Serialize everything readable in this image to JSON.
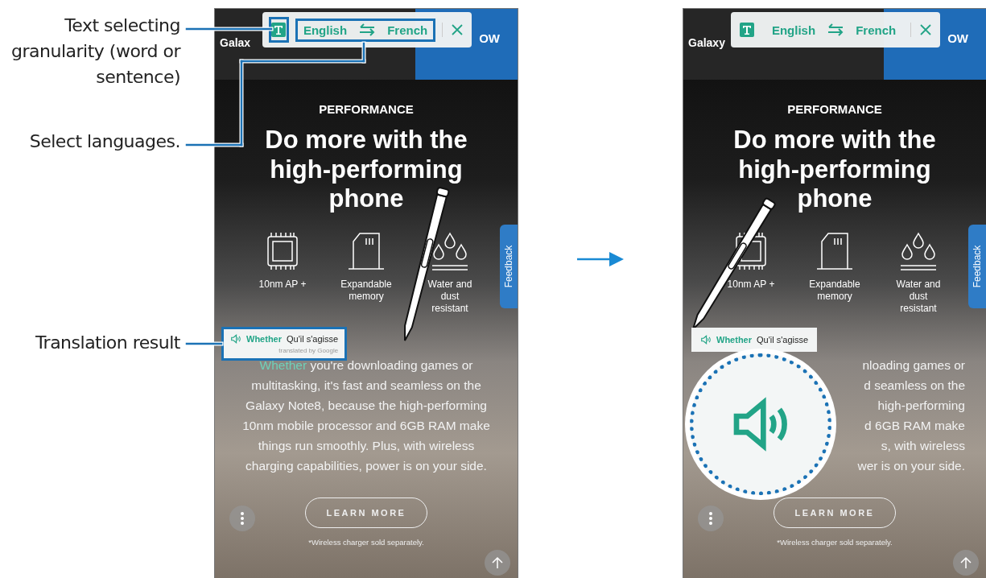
{
  "callouts": [
    {
      "text": "Text selecting granularity (word or sentence)"
    },
    {
      "text": "Select languages."
    },
    {
      "text": "Translation result"
    }
  ],
  "screens": [
    {
      "kind": "plain",
      "header": {
        "title": "Galax",
        "button": "OW"
      },
      "toolbar": {
        "source": "English",
        "target": "French",
        "highlighted": true
      },
      "section_label": "PERFORMANCE",
      "headline": [
        "Do more with the",
        "high-performing",
        "phone"
      ],
      "features": [
        {
          "label": "10nm AP +"
        },
        {
          "label": "Expandable memory"
        },
        {
          "label": "Water and dust resistant"
        }
      ],
      "feedback": "Feedback",
      "popup": {
        "source_word": "Whether",
        "translation": "Qu'il s'agisse",
        "credit": "translated by Google",
        "highlighted": true
      },
      "paragraph": {
        "selected_word": "Whether",
        "lines": [
          "you're downloading games or",
          "multitasking, it's fast and seamless on the",
          "Galaxy Note8, because the high-performing",
          "10nm mobile processor and 6GB RAM make",
          "things run smoothly. Plus, with wireless",
          "charging capabilities, power is on your side."
        ]
      },
      "cta": "LEARN MORE",
      "footnote": "*Wireless charger sold separately."
    },
    {
      "kind": "magnified",
      "header": {
        "title": "Galaxy",
        "button": "OW"
      },
      "toolbar": {
        "source": "English",
        "target": "French",
        "highlighted": false
      },
      "section_label": "PERFORMANCE",
      "headline": [
        "Do more with the",
        "high-performing",
        "phone"
      ],
      "features": [
        {
          "label": "10nm AP +"
        },
        {
          "label": "Expandable memory"
        },
        {
          "label": "Water and dust resistant"
        }
      ],
      "feedback": "Feedback",
      "popup": {
        "source_word": "Whether",
        "translation": "Qu'il s'agisse",
        "highlighted": false
      },
      "paragraph": {
        "lines": [
          "nloading games or",
          "d seamless on the",
          "high-performing",
          "d 6GB RAM make",
          "s, with wireless",
          "wer is on your side."
        ]
      },
      "cta": "LEARN MORE",
      "footnote": "*Wireless charger sold separately."
    }
  ]
}
